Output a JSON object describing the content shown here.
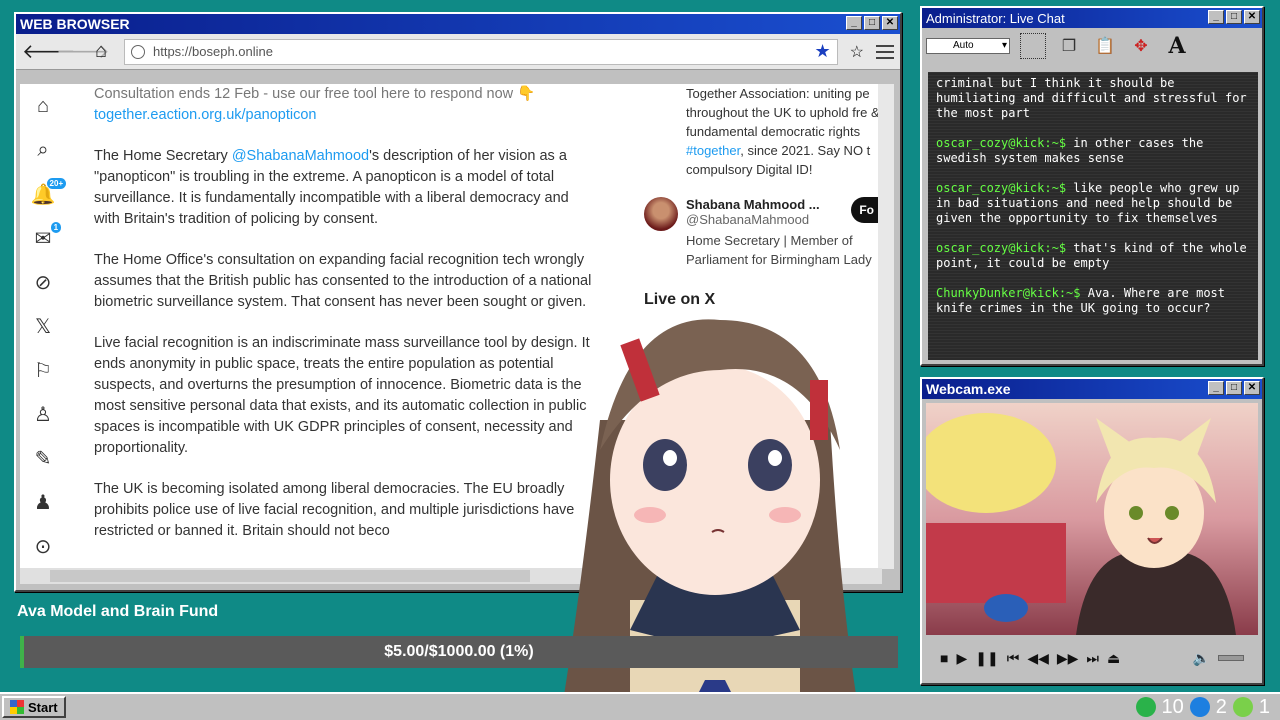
{
  "browser": {
    "title": "WEB BROWSER",
    "url": "https://boseph.online",
    "left_nav_badges": {
      "notifications": "20+",
      "messages": "1"
    },
    "tweet": {
      "line_consult": "Consultation ends 12 Feb - use our free tool here to respond now 👇",
      "link": "together.eaction.org.uk/panopticon",
      "p1_pre": "The Home Secretary ",
      "p1_mention": "@ShabanaMahmood",
      "p1_post": "'s description of her vision as a \"panopticon\" is troubling in the extreme. A panopticon is a model of total surveillance. It is fundamentally incompatible with a liberal democracy and with Britain's tradition of policing by consent.",
      "p2": "The Home Office's consultation on expanding facial recognition tech wrongly assumes that the British public has consented to the introduction of a national biometric surveillance system. That consent has never been sought or given.",
      "p3": "Live facial recognition is an indiscriminate mass surveillance tool by design. It ends anonymity in public space, treats the entire population as potential suspects, and overturns the presumption of innocence. Biometric data is the most sensitive personal data that exists, and its automatic collection in public spaces is incompatible with UK GDPR principles of consent, necessity and proportionality.",
      "p4": "The UK is becoming isolated among liberal democracies. The EU broadly prohibits police use of live facial recognition, and multiple jurisdictions have restricted or banned it. Britain should not beco"
    },
    "sidebar": {
      "promo_pre": "Together Association: uniting pe throughout the UK to uphold fre & fundamental democratic rights ",
      "promo_tag": "#together",
      "promo_post": ", since 2021. Say NO t compulsory Digital ID!",
      "account_name": "Shabana Mahmood ...",
      "account_handle": "@ShabanaMahmood",
      "account_bio": "Home Secretary | Member of Parliament for Birmingham Lady",
      "follow_label": "Fo",
      "live_on": "Live on X"
    }
  },
  "fund": {
    "title": "Ava Model and Brain Fund",
    "progress_text": "$5.00/$1000.00 (1%)",
    "progress_fraction": 0.005
  },
  "chat": {
    "title": "Administrator: Live Chat",
    "select_value": "Auto",
    "messages": [
      {
        "user": "",
        "text": "criminal but I think it should be humiliating and difficult and stressful for the most part"
      },
      {
        "user": "oscar_cozy@kick:~$",
        "text": " in other cases the swedish system makes sense"
      },
      {
        "user": "oscar_cozy@kick:~$",
        "text": " like people who grew up in bad situations and need help should be given the opportunity to fix themselves"
      },
      {
        "user": "oscar_cozy@kick:~$",
        "text": " that's kind of the whole point, it could be empty"
      },
      {
        "user": "ChunkyDunker@kick:~$",
        "text": " Ava. Where are most knife crimes in the UK going to occur?"
      }
    ]
  },
  "webcam": {
    "title": "Webcam.exe"
  },
  "taskbar": {
    "start_label": "Start",
    "tray_count_1": "10",
    "tray_count_2": "2",
    "tray_count_3": "1"
  },
  "colors": {
    "desktop": "#0f8a86",
    "titlebar": "#0a1e8c",
    "chat_user": "#66ff44",
    "link": "#1d9bf0"
  }
}
